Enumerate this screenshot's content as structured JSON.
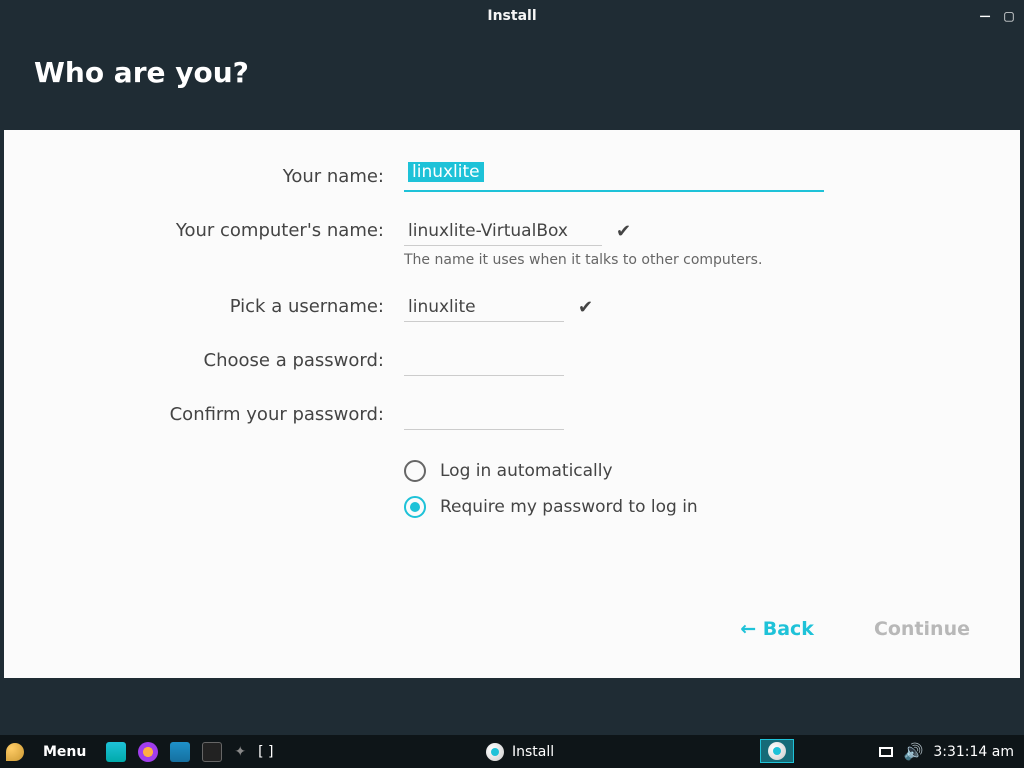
{
  "window": {
    "title": "Install"
  },
  "header": {
    "title": "Who are you?"
  },
  "form": {
    "name_label": "Your name:",
    "name_value": "linuxlite",
    "hostname_label": "Your computer's name:",
    "hostname_value": "linuxlite-VirtualBox",
    "hostname_helper": "The name it uses when it talks to other computers.",
    "user_label": "Pick a username:",
    "user_value": "linuxlite",
    "pw_label": "Choose a password:",
    "pw_value": "",
    "pw2_label": "Confirm your password:",
    "pw2_value": "",
    "auto_login_label": "Log in automatically",
    "require_pw_label": "Require my password to log in",
    "login_mode_selected": "require_pw"
  },
  "nav": {
    "back": "Back",
    "continue": "Continue"
  },
  "taskbar": {
    "menu": "Menu",
    "workspaces": "[ ]",
    "active_task": "Install",
    "clock": "3:31:14 am"
  }
}
